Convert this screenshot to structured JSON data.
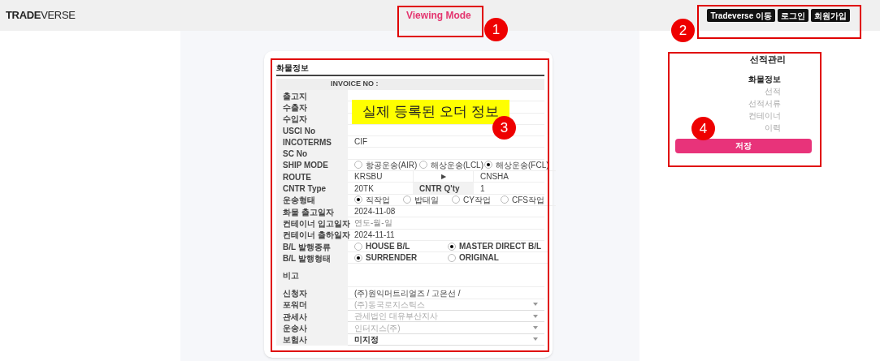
{
  "header": {
    "logo": "**TRADE**VERSE",
    "mode": "Viewing Mode",
    "buttons": [
      "Tradeverse 이동",
      "로그인",
      "회원가입"
    ]
  },
  "form": {
    "title": "화물정보",
    "invoice": "INVOICE NO :",
    "rows": [
      {
        "label": "출고지",
        "kind": "text"
      },
      {
        "label": "수출자",
        "kind": "text"
      },
      {
        "label": "수입자",
        "kind": "text"
      },
      {
        "label": "USCI No",
        "kind": "text"
      },
      {
        "label": "INCOTERMS",
        "kind": "text",
        "value": "CIF"
      },
      {
        "label": "SC No",
        "kind": "text"
      },
      {
        "label": "SHIP MODE",
        "kind": "radio",
        "options": [
          {
            "label": "항공운송(AIR)",
            "selected": false
          },
          {
            "label": "해상운송(LCL)",
            "selected": false
          },
          {
            "label": "해상운송(FCL)",
            "selected": true
          }
        ]
      },
      {
        "label": "ROUTE",
        "kind": "route",
        "from": "KRSBU",
        "arrow": "▶",
        "to": "CNSHA"
      },
      {
        "label": "CNTR Type",
        "kind": "pair",
        "value": "20TK",
        "label2": "CNTR Q'ty",
        "value2": "1"
      },
      {
        "label": "운송형태",
        "kind": "radio",
        "options": [
          {
            "label": "직작업",
            "selected": true
          },
          {
            "label": "밥태일",
            "selected": false
          },
          {
            "label": "CY작업",
            "selected": false
          },
          {
            "label": "CFS작업",
            "selected": false
          }
        ]
      },
      {
        "label": "화물 출고일자",
        "kind": "text",
        "value": "2024-11-08"
      },
      {
        "label": "컨테이너 입고일자",
        "kind": "text",
        "placeholder": "연도-월-일"
      },
      {
        "label": "컨테이너 출하일자",
        "kind": "text",
        "value": "2024-11-11"
      },
      {
        "label": "B/L 발행종류",
        "kind": "radio",
        "options": [
          {
            "label": "HOUSE B/L",
            "selected": false
          },
          {
            "label": "MASTER DIRECT B/L",
            "selected": true
          }
        ]
      },
      {
        "label": "B/L 발행형태",
        "kind": "radio",
        "options": [
          {
            "label": "SURRENDER",
            "selected": true
          },
          {
            "label": "ORIGINAL",
            "selected": false
          }
        ]
      },
      {
        "label": "비고",
        "kind": "remark"
      },
      {
        "label": "신청자",
        "kind": "text",
        "value": "(주)원익머트리얼즈 /  고은선 /"
      },
      {
        "label": "포워더",
        "kind": "select",
        "value": "(주)동국로지스틱스",
        "disabled": true
      },
      {
        "label": "관세사",
        "kind": "select",
        "value": "관세법인 대유부산지사",
        "disabled": true
      },
      {
        "label": "운송사",
        "kind": "select",
        "value": "인터지스(주)",
        "disabled": true
      },
      {
        "label": "보험사",
        "kind": "select",
        "value": "미지정",
        "disabled": false
      }
    ]
  },
  "side_panel": {
    "title": "선적관리",
    "items": [
      {
        "label": "화물정보",
        "selected": true
      },
      {
        "label": "선적",
        "selected": false
      },
      {
        "label": "선적서류",
        "selected": false
      },
      {
        "label": "컨테이너",
        "selected": false
      },
      {
        "label": "이력",
        "selected": false
      }
    ],
    "save_button": "저장"
  },
  "annotations": {
    "note": "실제 등록된 오더 정보",
    "markers": [
      "1",
      "2",
      "3",
      "4"
    ]
  }
}
